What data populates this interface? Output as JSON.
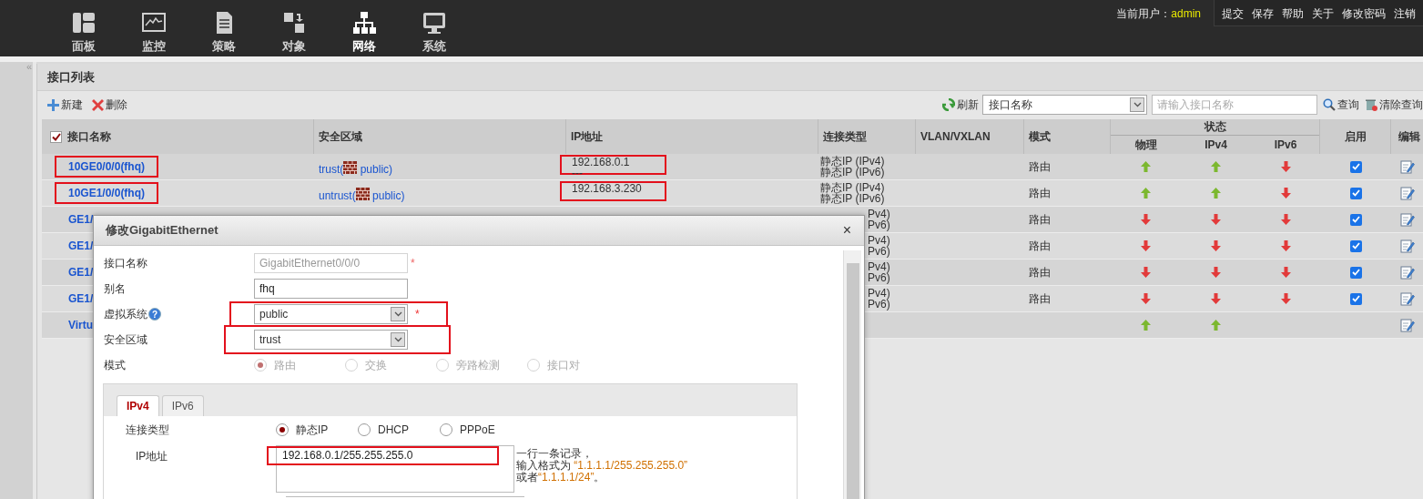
{
  "topbar": {
    "nav": [
      {
        "label": "面板",
        "kind": "panel",
        "selected": false
      },
      {
        "label": "监控",
        "kind": "monitor",
        "selected": false
      },
      {
        "label": "策略",
        "kind": "policy",
        "selected": false
      },
      {
        "label": "对象",
        "kind": "object",
        "selected": false
      },
      {
        "label": "网络",
        "kind": "network",
        "selected": true
      },
      {
        "label": "系统",
        "kind": "system",
        "selected": false
      }
    ],
    "user_label": "当前用户：",
    "user": "admin",
    "links": [
      "提交",
      "保存",
      "帮助",
      "关于",
      "修改密码",
      "注销"
    ]
  },
  "sidebar": {
    "toggle": "«"
  },
  "panel": {
    "title": "接口列表",
    "toolbar": {
      "add": "新建",
      "delete": "删除",
      "refresh": "刷新",
      "filter": "接口名称",
      "search_placeholder": "请输入接口名称",
      "query": "查询",
      "clear": "清除查询"
    },
    "table": {
      "select_all": {
        "checked": true
      },
      "columns": [
        "接口名称",
        "安全区域",
        "IP地址",
        "连接类型",
        "VLAN/VXLAN",
        "模式"
      ],
      "status_group": "状态",
      "status_columns": [
        "物理",
        "IPv4",
        "IPv6"
      ],
      "enabled_column": "启用",
      "edit_column": "编辑",
      "rows": [
        {
          "kind": "full",
          "name": "10GE0/0/0(fhq)",
          "name_annotated": true,
          "zone": "trust(",
          "vsys": "public)",
          "ip": [
            "192.168.0.1",
            "---"
          ],
          "ip_annotated": true,
          "conn": [
            "静态IP (IPv4)",
            "静态IP (IPv6)"
          ],
          "mode": "路由",
          "phys_up": true,
          "ipv4_up": true,
          "ipv6_up": false,
          "enabled": true
        },
        {
          "kind": "full",
          "name": "10GE1/0/0(fhq)",
          "name_annotated": true,
          "zone": "untrust(",
          "vsys": "public)",
          "ip": [
            "192.168.3.230"
          ],
          "ip_annotated": true,
          "conn": [
            "静态IP (IPv4)",
            "静态IP (IPv6)"
          ],
          "mode": "路由",
          "phys_up": true,
          "ipv4_up": true,
          "ipv6_up": false,
          "enabled": true
        },
        {
          "kind": "covered",
          "name": "GE1/",
          "conn": [
            "Pv4)",
            "Pv6)"
          ],
          "mode": "路由",
          "phys_up": false,
          "ipv4_up": false,
          "ipv6_up": false,
          "enabled": true
        },
        {
          "kind": "covered",
          "name": "GE1/",
          "conn": [
            "Pv4)",
            "Pv6)"
          ],
          "mode": "路由",
          "phys_up": false,
          "ipv4_up": false,
          "ipv6_up": false,
          "enabled": true
        },
        {
          "kind": "covered",
          "name": "GE1/",
          "conn": [
            "Pv4)",
            "Pv6)"
          ],
          "mode": "路由",
          "phys_up": false,
          "ipv4_up": false,
          "ipv6_up": false,
          "enabled": true
        },
        {
          "kind": "covered",
          "name": "GE1/",
          "conn": [
            "Pv4)",
            "Pv6)"
          ],
          "mode": "路由",
          "phys_up": false,
          "ipv4_up": false,
          "ipv6_up": false,
          "enabled": true
        },
        {
          "kind": "covered",
          "name": "Virtu",
          "conn": [],
          "phys_up": true,
          "ipv4_up": true
        }
      ]
    }
  },
  "dialog": {
    "title": "修改GigabitEthernet",
    "close": "×",
    "fields": [
      {
        "kind": "input",
        "label": "接口名称",
        "value": "GigabitEthernet0/0/0",
        "disabled": true,
        "required": "*"
      },
      {
        "kind": "input",
        "label": "别名",
        "value": "fhq",
        "disabled": false
      },
      {
        "kind": "select",
        "label": "虚拟系统",
        "help": "?",
        "value": "public",
        "required": "*",
        "annotated": true
      },
      {
        "kind": "select",
        "label": "安全区域",
        "value": "trust",
        "annotated": true
      },
      {
        "kind": "radio",
        "label": "模式",
        "disabled": true,
        "options": [
          {
            "label": "路由",
            "selected": true
          },
          {
            "label": "交换",
            "selected": false
          },
          {
            "label": "旁路检测",
            "selected": false
          },
          {
            "label": "接口对",
            "selected": false
          }
        ]
      }
    ],
    "tabs": [
      {
        "label": "IPv4",
        "selected": true
      },
      {
        "label": "IPv6",
        "selected": false
      }
    ],
    "conn_type": {
      "label": "连接类型",
      "options": [
        {
          "label": "静态IP",
          "selected": true
        },
        {
          "label": "DHCP",
          "selected": false
        },
        {
          "label": "PPPoE",
          "selected": false
        }
      ]
    },
    "ip": {
      "label": "IP地址",
      "value": "192.168.0.1/255.255.255.0",
      "annotated": true,
      "hint": [
        [
          {
            "text": "一行一条记录，",
            "emphasis": false
          }
        ],
        [
          {
            "text": "输入格式为 ",
            "emphasis": false
          },
          {
            "text": "“1.1.1.1/255.255.255.0”",
            "emphasis": true
          }
        ],
        [
          {
            "text": "或者",
            "emphasis": false
          },
          {
            "text": "“1.1.1.1/24”",
            "emphasis": true
          },
          {
            "text": "。",
            "emphasis": false
          }
        ]
      ]
    }
  }
}
